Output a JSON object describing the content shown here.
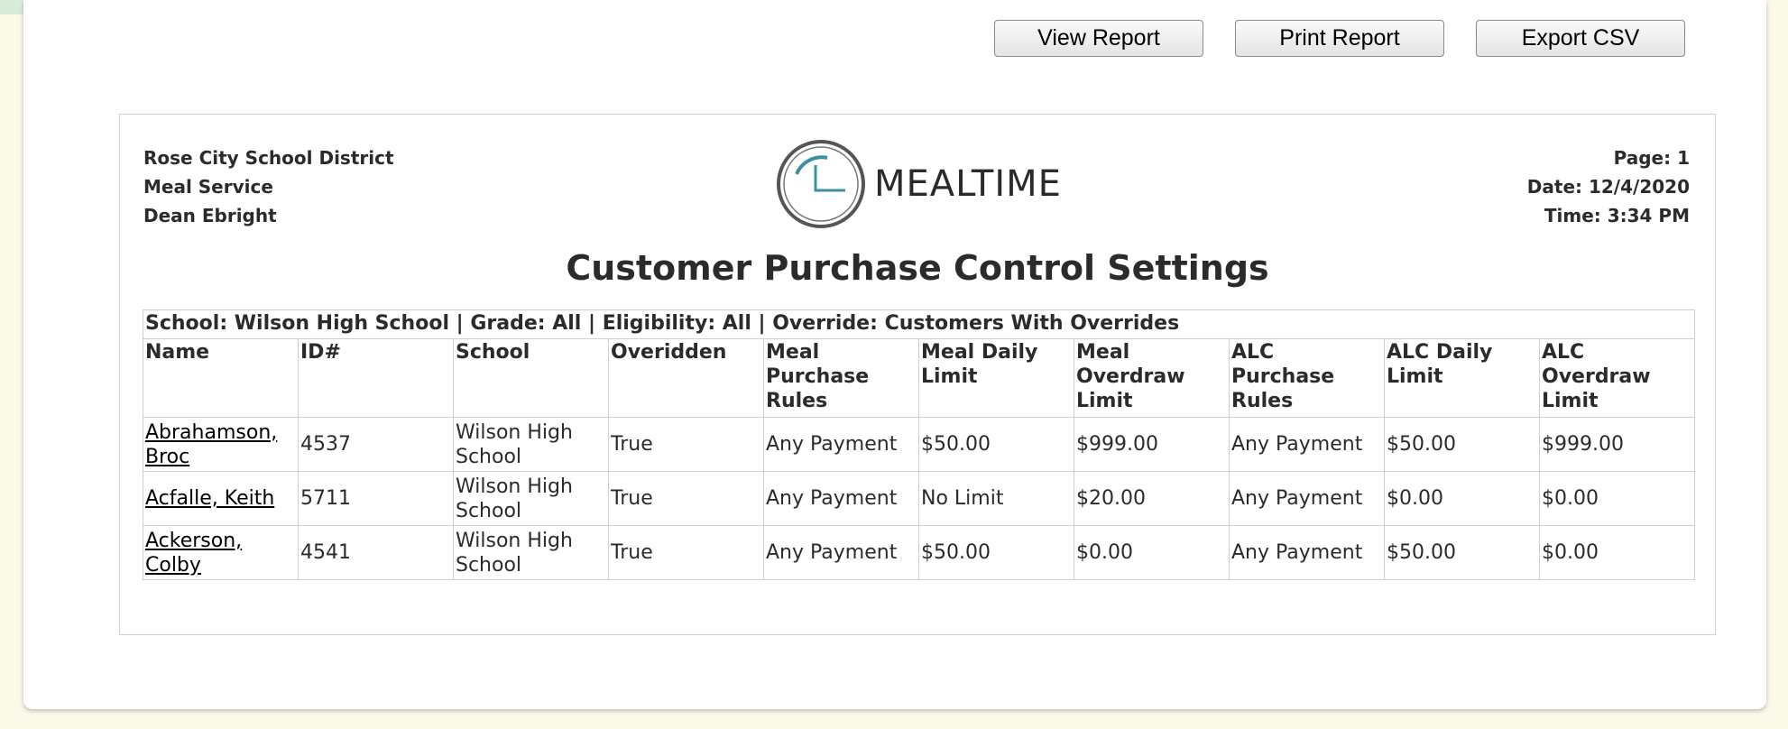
{
  "toolbar": {
    "view_label": "View Report",
    "print_label": "Print Report",
    "export_label": "Export CSV"
  },
  "report": {
    "district": "Rose City School District",
    "department": "Meal Service",
    "user": "Dean Ebright",
    "page": "Page: 1",
    "date": "Date: 12/4/2020",
    "time": "Time: 3:34 PM",
    "logo_text": "MEALTIME",
    "title": "Customer Purchase Control Settings",
    "filter": "School: Wilson High School | Grade: All | Eligibility: All | Override: Customers With Overrides",
    "columns": [
      "Name",
      "ID#",
      "School",
      "Overidden",
      "Meal Purchase Rules",
      "Meal Daily Limit",
      "Meal Overdraw Limit",
      "ALC Purchase Rules",
      "ALC Daily Limit",
      "ALC Overdraw Limit"
    ],
    "rows": [
      {
        "name": "Abrahamson, Broc",
        "id": "4537",
        "school": "Wilson High School",
        "overridden": "True",
        "meal_rules": "Any Payment",
        "meal_daily": "$50.00",
        "meal_overdraw": "$999.00",
        "alc_rules": "Any Payment",
        "alc_daily": "$50.00",
        "alc_overdraw": "$999.00"
      },
      {
        "name": "Acfalle, Keith",
        "id": "5711",
        "school": "Wilson High School",
        "overridden": "True",
        "meal_rules": "Any Payment",
        "meal_daily": "No Limit",
        "meal_overdraw": "$20.00",
        "alc_rules": "Any Payment",
        "alc_daily": "$0.00",
        "alc_overdraw": "$0.00"
      },
      {
        "name": "Ackerson, Colby",
        "id": "4541",
        "school": "Wilson High School",
        "overridden": "True",
        "meal_rules": "Any Payment",
        "meal_daily": "$50.00",
        "meal_overdraw": "$0.00",
        "alc_rules": "Any Payment",
        "alc_daily": "$50.00",
        "alc_overdraw": "$0.00"
      }
    ]
  },
  "colors": {
    "background": "#fbf9e8",
    "logo_teal": "#3a8fa0",
    "logo_ring": "#555555"
  }
}
